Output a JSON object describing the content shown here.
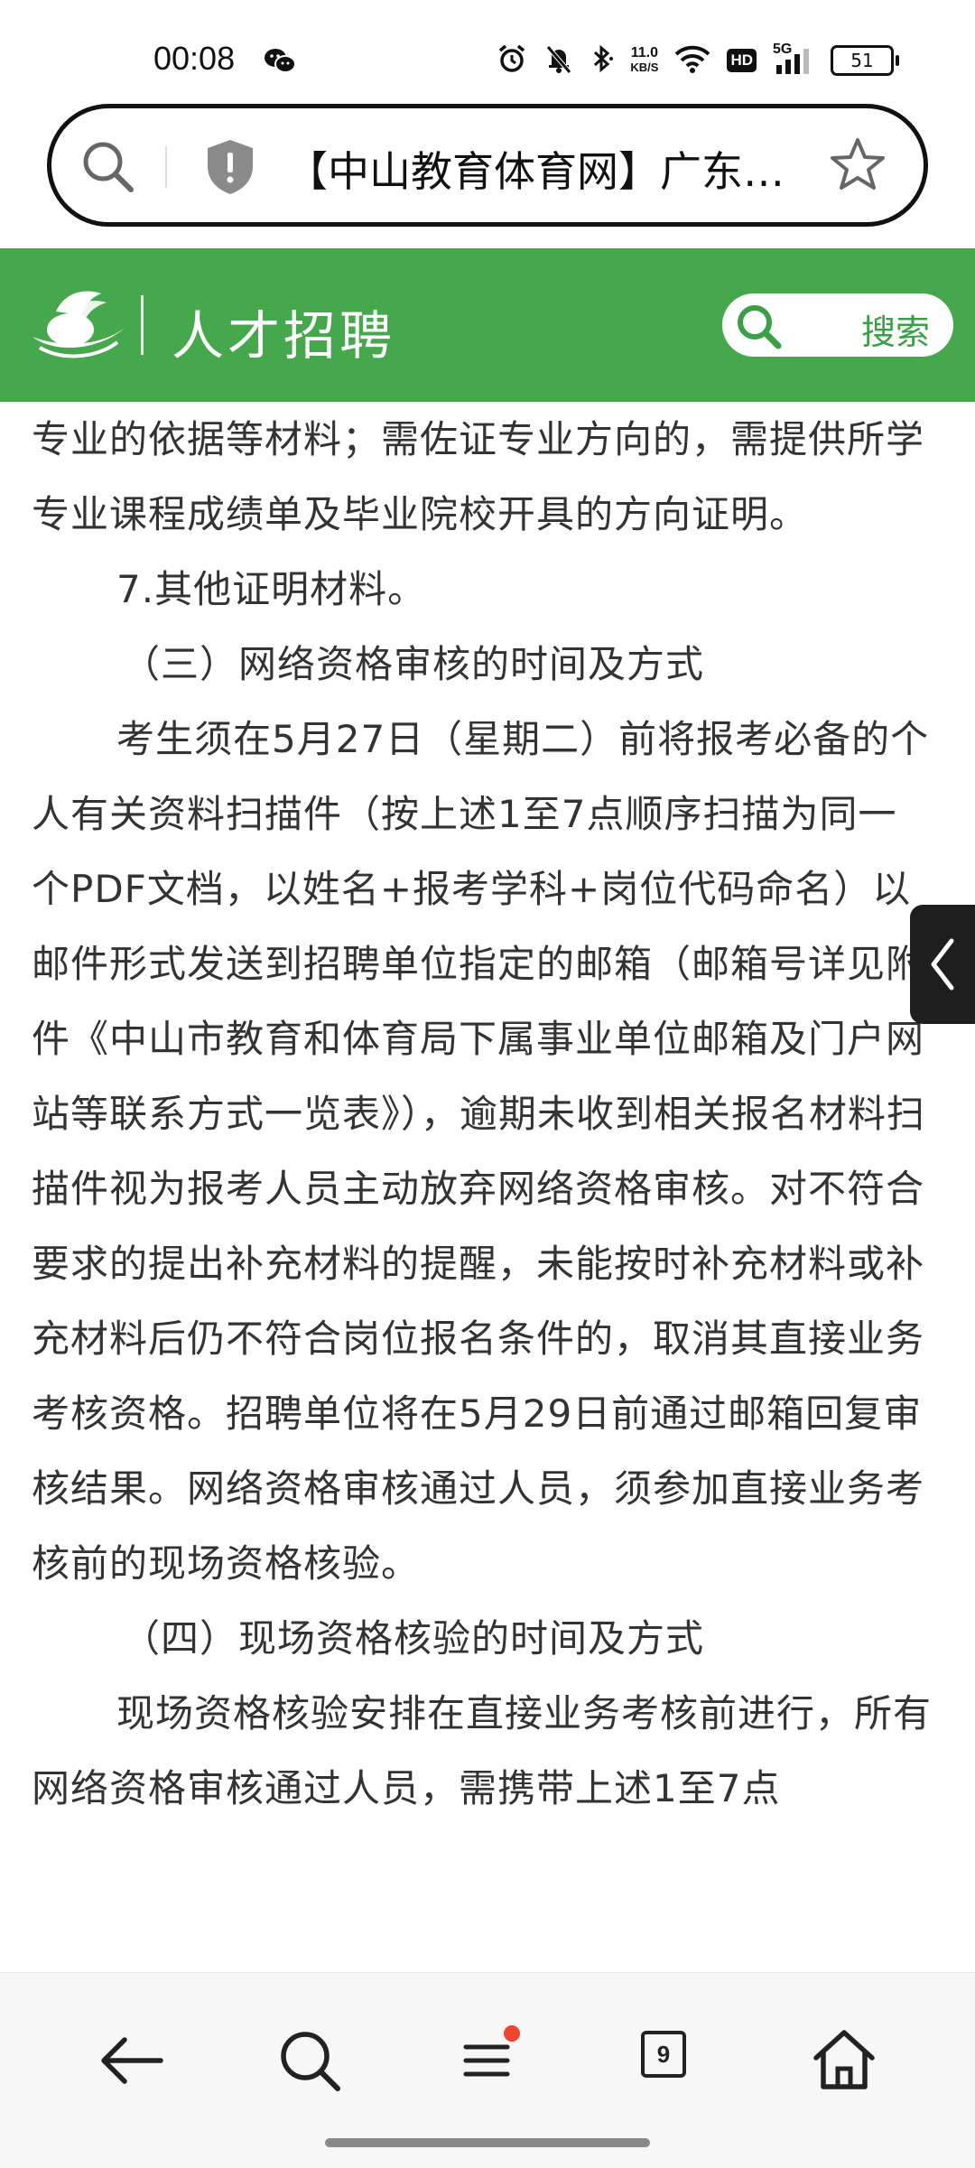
{
  "status_bar": {
    "time": "00:08",
    "net_speed_value": "11.0",
    "net_speed_unit": "KB/S",
    "network_label": "5G",
    "hd_label": "HD",
    "battery": "51"
  },
  "address_bar": {
    "title": "【中山教育体育网】广东…"
  },
  "header": {
    "title": "人才招聘",
    "search_label": "搜索",
    "color": "#45a84c"
  },
  "article": {
    "p1": "专业的依据等材料；需佐证专业方向的，需提供所学专业课程成绩单及毕业院校开具的方向证明。",
    "p2": "7.其他证明材料。",
    "h3": "（三）网络资格审核的时间及方式",
    "p3": "考生须在5月27日（星期二）前将报考必备的个人有关资料扫描件（按上述1至7点顺序扫描为同一个PDF文档，以姓名+报考学科+岗位代码命名）以邮件形式发送到招聘单位指定的邮箱（邮箱号详见附件《中山市教育和体育局下属事业单位邮箱及门户网站等联系方式一览表》），逾期未收到相关报名材料扫描件视为报考人员主动放弃网络资格审核。对不符合要求的提出补充材料的提醒，未能按时补充材料或补充材料后仍不符合岗位报名条件的，取消其直接业务考核资格。招聘单位将在5月29日前通过邮箱回复审核结果。网络资格审核通过人员，须参加直接业务考核前的现场资格核验。",
    "h4": "（四）现场资格核验的时间及方式",
    "p4": "现场资格核验安排在直接业务考核前进行，所有网络资格审核通过人员，需携带上述1至7点"
  },
  "bottom_nav": {
    "tab_count": "9"
  }
}
